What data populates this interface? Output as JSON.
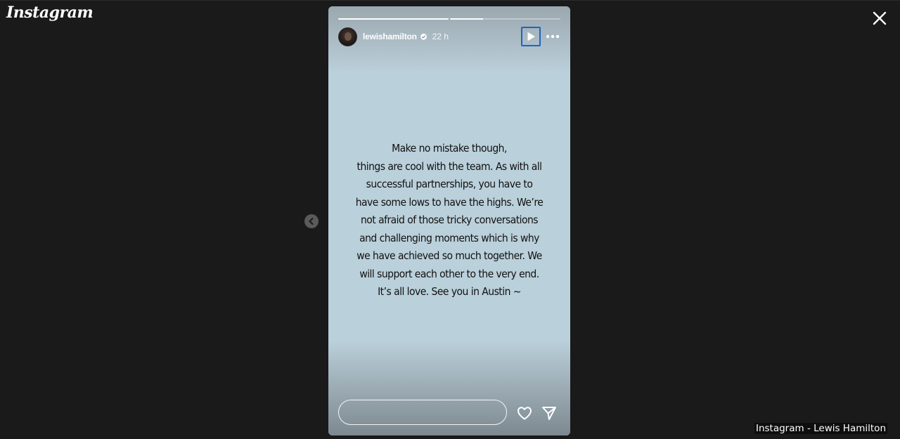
{
  "app": {
    "logo_text": "Instagram"
  },
  "icons": {
    "close": "close-icon",
    "prev": "chevron-left-icon",
    "play": "play-icon",
    "more": "more-horizontal-icon",
    "verified": "verified-badge-icon",
    "like": "heart-icon",
    "share": "send-icon"
  },
  "story": {
    "progress": [
      1,
      0.3
    ],
    "username": "lewishamilton",
    "time": "22 h",
    "text_lines": [
      "Make no mistake though,",
      "things are cool with the team. As with all",
      "successful partnerships, you have to",
      "have some lows to have the highs. We’re",
      "not afraid of those tricky conversations",
      "and challenging moments which is why",
      "we have achieved so much together. We",
      "will support each other to the very end.",
      "It’s all love. See you in Austin ~"
    ],
    "reply_placeholder": ""
  },
  "caption": "Instagram - Lewis Hamilton",
  "colors": {
    "play_focus_border": "#1d63c7",
    "story_background": "#bad0db",
    "page_background": "#1a1a1a"
  }
}
